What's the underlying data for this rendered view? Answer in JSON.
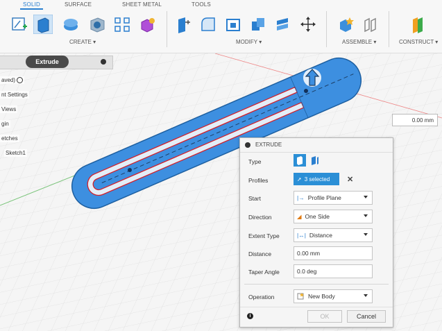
{
  "toolbar": {
    "tabs": [
      "SOLID",
      "SURFACE",
      "SHEET METAL",
      "TOOLS"
    ],
    "groups": {
      "create": "CREATE",
      "modify": "MODIFY",
      "assemble": "ASSEMBLE",
      "construct": "CONSTRUCT"
    }
  },
  "browser": {
    "active_command": "Extrude",
    "items": [
      "aved)",
      "nt Settings",
      "Views",
      "gin",
      "etches",
      "Sketch1"
    ]
  },
  "canvas": {
    "distance_tag": "0.00 mm"
  },
  "dialog": {
    "title": "EXTRUDE",
    "rows": {
      "type": {
        "label": "Type"
      },
      "profiles": {
        "label": "Profiles",
        "value": "3 selected"
      },
      "start": {
        "label": "Start",
        "value": "Profile Plane"
      },
      "direction": {
        "label": "Direction",
        "value": "One Side"
      },
      "extent_type": {
        "label": "Extent Type",
        "value": "Distance"
      },
      "distance": {
        "label": "Distance",
        "value": "0.00 mm"
      },
      "taper_angle": {
        "label": "Taper Angle",
        "value": "0.0 deg"
      },
      "operation": {
        "label": "Operation",
        "value": "New Body"
      }
    },
    "ok_label": "OK",
    "cancel_label": "Cancel"
  },
  "colors": {
    "accent": "#2a7fd0",
    "profile_blue": "#3d8fe0",
    "profile_edge": "#d2202a"
  }
}
